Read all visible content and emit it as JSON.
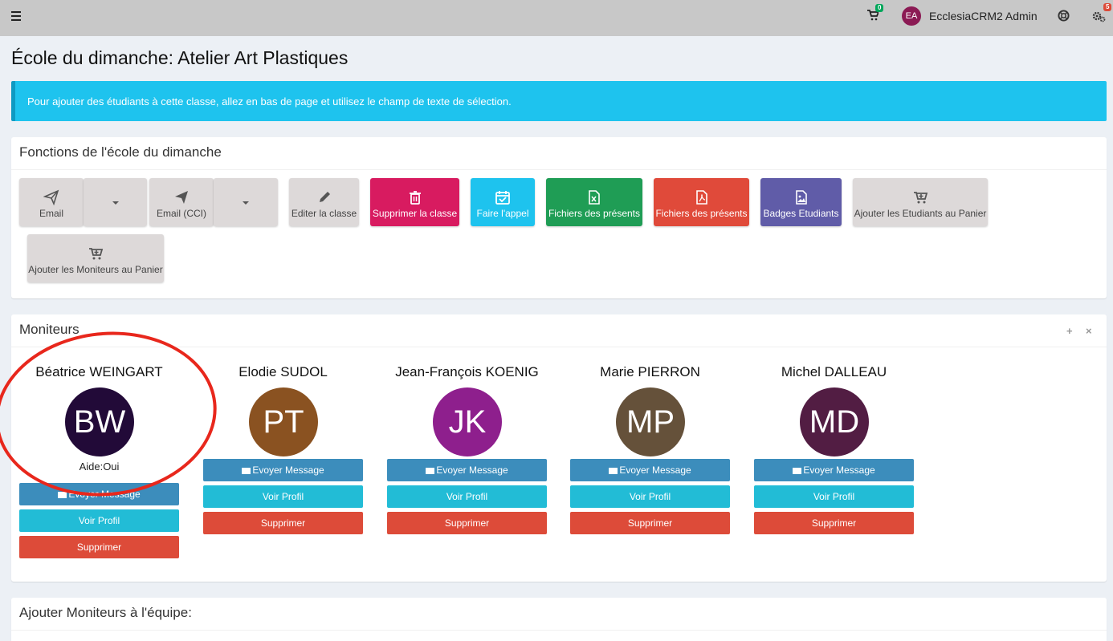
{
  "topbar": {
    "cart_count": "0",
    "user_initials": "EA",
    "user_name": "EcclesiaCRM2 Admin",
    "notif_count": "5"
  },
  "page_title": "École du dimanche: Atelier Art Plastiques",
  "callout_text": "Pour ajouter des étudiants à cette classe, allez en bas de page et utilisez le champ de texte de sélection.",
  "functions": {
    "title": "Fonctions de l'école du dimanche",
    "buttons": [
      {
        "label": "Email",
        "icon": "paper-plane-icon"
      },
      {
        "label": "Email (CCI)",
        "icon": "paper-plane-icon"
      },
      {
        "label": "Editer la classe",
        "icon": "pencil-icon"
      },
      {
        "label": "Supprimer la classe",
        "icon": "trash-icon"
      },
      {
        "label": "Faire l'appel",
        "icon": "calendar-check-icon"
      },
      {
        "label": "Fichiers des présents",
        "icon": "excel-file-icon"
      },
      {
        "label": "Fichiers des présents",
        "icon": "pdf-file-icon"
      },
      {
        "label": "Badges Etudiants",
        "icon": "image-file-icon"
      },
      {
        "label": "Ajouter les Etudiants au Panier",
        "icon": "cart-plus-icon"
      },
      {
        "label": "Ajouter les Moniteurs au Panier",
        "icon": "cart-plus-icon"
      }
    ]
  },
  "moniteurs": {
    "title": "Moniteurs",
    "send_label": "Evoyer Message",
    "profile_label": "Voir Profil",
    "delete_label": "Supprimer",
    "people": [
      {
        "name": "Béatrice WEINGART",
        "initials": "BW",
        "color": "#220a38",
        "aide": "Aide:Oui"
      },
      {
        "name": "Elodie SUDOL",
        "initials": "PT",
        "color": "#8a5221"
      },
      {
        "name": "Jean-François KOENIG",
        "initials": "JK",
        "color": "#8e1f8d"
      },
      {
        "name": "Marie PIERRON",
        "initials": "MP",
        "color": "#65513a"
      },
      {
        "name": "Michel DALLEAU",
        "initials": "MD",
        "color": "#521d43"
      }
    ]
  },
  "add_team": {
    "title": "Ajouter Moniteurs à l'équipe:"
  }
}
